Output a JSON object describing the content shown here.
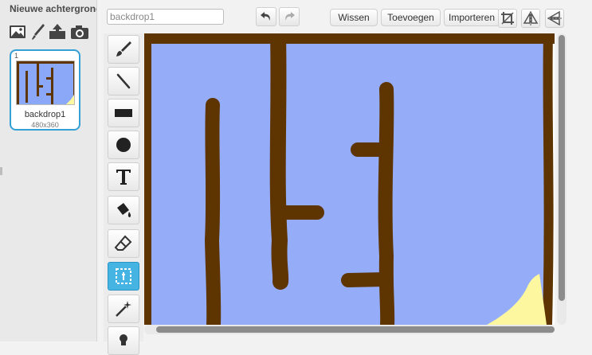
{
  "left_panel": {
    "new_backdrop_label": "Nieuwe achtergrond",
    "new_backdrop_icons": [
      "image-icon",
      "paint-brush-icon",
      "upload-icon",
      "camera-icon"
    ],
    "backdrops": [
      {
        "number": "1",
        "name": "backdrop1",
        "size": "480x360"
      }
    ]
  },
  "editor": {
    "name_input_value": "backdrop1",
    "buttons": {
      "clear": "Wissen",
      "add": "Toevoegen",
      "import": "Importeren"
    },
    "top_icons": [
      "undo-icon",
      "redo-icon",
      "crop-icon",
      "flip-horizontal-icon",
      "flip-vertical-icon"
    ],
    "tools": [
      "paintbrush-icon",
      "line-icon",
      "rectangle-icon",
      "ellipse-icon",
      "text-icon",
      "fill-icon",
      "eraser-icon",
      "select-icon",
      "magic-wand-icon",
      "stamp-icon"
    ],
    "active_tool": "select-icon"
  },
  "colors": {
    "sky": "#95adf9",
    "maze_walls": "#5e3500",
    "sand": "#fdf7a0",
    "accent": "#33a0d6"
  }
}
